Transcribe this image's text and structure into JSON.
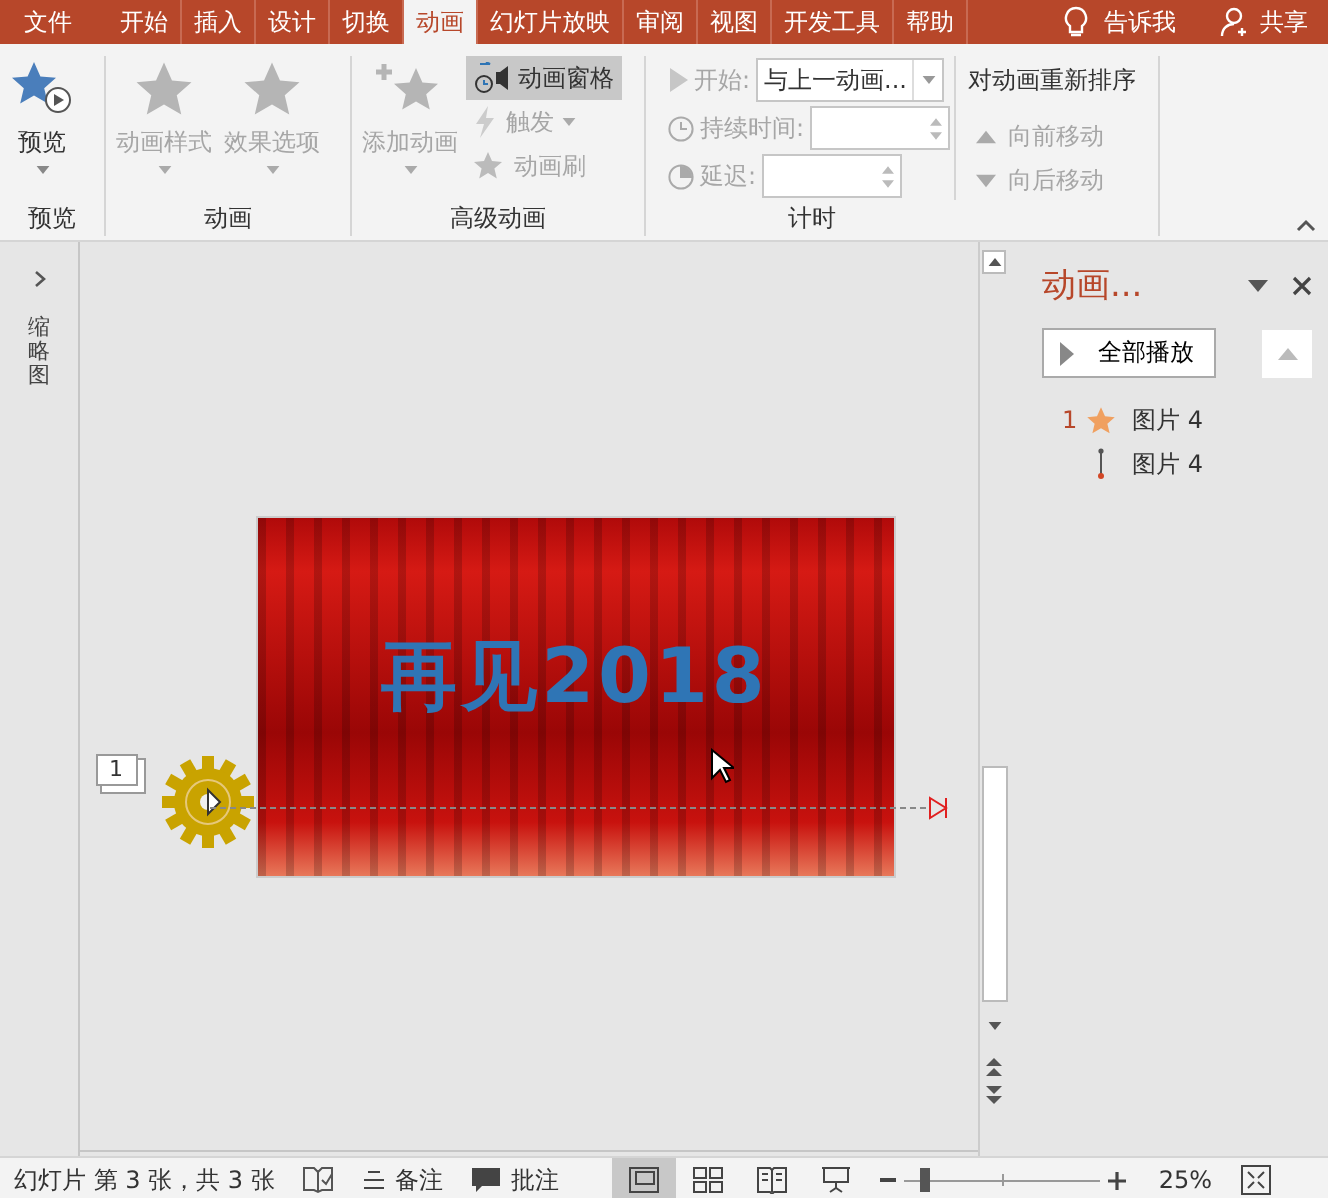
{
  "tabs": [
    {
      "label": "文件",
      "selected": false
    },
    {
      "label": "开始",
      "selected": false
    },
    {
      "label": "插入",
      "selected": false
    },
    {
      "label": "设计",
      "selected": false
    },
    {
      "label": "切换",
      "selected": false
    },
    {
      "label": "动画",
      "selected": true
    },
    {
      "label": "幻灯片放映",
      "selected": false
    },
    {
      "label": "审阅",
      "selected": false
    },
    {
      "label": "视图",
      "selected": false
    },
    {
      "label": "开发工具",
      "selected": false
    },
    {
      "label": "帮助",
      "selected": false
    }
  ],
  "tell_me": "告诉我",
  "share": "共享",
  "ribbon": {
    "preview": {
      "label": "预览",
      "button": {
        "label": "预览",
        "disabled": false
      }
    },
    "animation": {
      "label": "动画",
      "buttons": [
        {
          "label": "动画样式",
          "disabled": true
        },
        {
          "label": "效果选项",
          "disabled": true
        }
      ]
    },
    "advanced": {
      "label": "高级动画",
      "add": {
        "label": "添加动画",
        "disabled": true
      },
      "small": [
        {
          "label": "动画窗格",
          "selected": true,
          "disabled": false
        },
        {
          "label": "触发",
          "selected": false,
          "disabled": true
        },
        {
          "label": "动画刷",
          "selected": false,
          "disabled": true
        }
      ]
    },
    "timing": {
      "label": "计时",
      "fields": [
        {
          "label": "开始:",
          "value": "与上一动画...",
          "kind": "dropdown",
          "disabled": true
        },
        {
          "label": "持续时间:",
          "kind": "spinner",
          "disabled": true
        },
        {
          "label": "延迟:",
          "kind": "spinner",
          "disabled": true
        }
      ],
      "reorder_title": "对动画重新排序",
      "reorder": [
        {
          "label": "向前移动",
          "disabled": true
        },
        {
          "label": "向后移动",
          "disabled": true
        }
      ]
    }
  },
  "thumbnails_label": "缩略图",
  "slide": {
    "title": "再见2018",
    "animation_tag": "1"
  },
  "animation_pane": {
    "title": "动画...",
    "play_all": "全部播放",
    "items": [
      {
        "number": "1",
        "name": "图片 4",
        "kind": "star"
      },
      {
        "name": "图片 4",
        "kind": "path"
      }
    ]
  },
  "status_bar": {
    "slide_info": "幻灯片 第 3 张，共 3 张",
    "notes": "备注",
    "comments": "批注",
    "views": [
      {
        "kind": "normal",
        "selected": true
      },
      {
        "kind": "sorter",
        "selected": false
      },
      {
        "kind": "reading",
        "selected": false
      },
      {
        "kind": "show",
        "selected": false
      }
    ],
    "zoom": {
      "level": 0.1,
      "reading": "25%"
    }
  }
}
